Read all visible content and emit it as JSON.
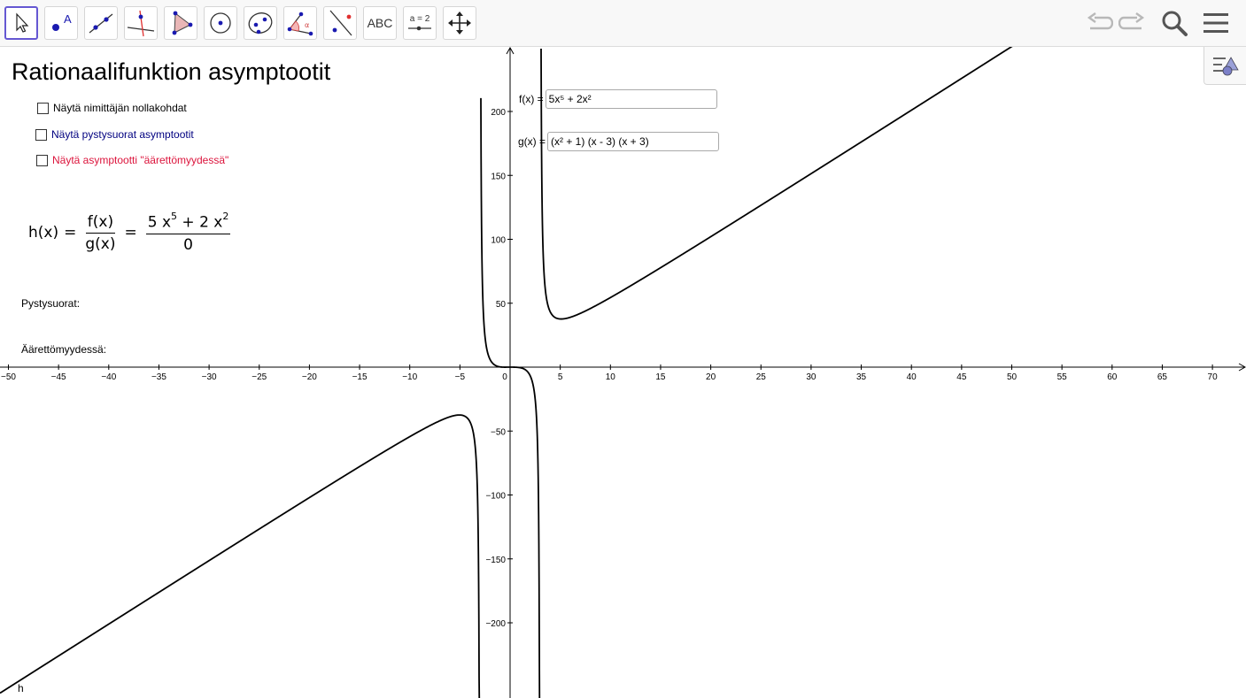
{
  "toolbar": {
    "tools": [
      {
        "name": "move-tool"
      },
      {
        "name": "point-tool",
        "label": "A"
      },
      {
        "name": "line-tool"
      },
      {
        "name": "perpendicular-line-tool"
      },
      {
        "name": "polygon-tool"
      },
      {
        "name": "circle-tool"
      },
      {
        "name": "ellipse-tool"
      },
      {
        "name": "angle-tool",
        "label": "α"
      },
      {
        "name": "reflect-tool"
      },
      {
        "name": "text-tool",
        "label": "ABC"
      },
      {
        "name": "slider-tool",
        "label": "a = 2"
      },
      {
        "name": "move-graphics-view-tool"
      }
    ],
    "accent_color": "#6557d2"
  },
  "title": "Rationaalifunktion asymptootit",
  "checkboxes": [
    {
      "label": "Näytä nimittäjän nollakohdat",
      "checked": false,
      "color": "#000000"
    },
    {
      "label": "Näytä pystysuorat asymptootit",
      "checked": false,
      "color": "#000080"
    },
    {
      "label": "Näytä asymptootti \"äärettömyydessä\"",
      "checked": false,
      "color": "#dc143c"
    }
  ],
  "formula": {
    "lhs": "h(x)",
    "num": "f(x)",
    "den": "g(x)",
    "num2_a": "5 x",
    "num2_exp_a": "5",
    "num2_b": " + 2 x",
    "num2_exp_b": "2",
    "den2": "0"
  },
  "labels": {
    "vertical": "Pystysuorat:",
    "infinity": "Äärettömyydessä:",
    "curve": "h"
  },
  "inputs": {
    "f_label": "f(x) =",
    "f_value": "5x⁵ + 2x²",
    "g_label": "g(x) =",
    "g_value": "(x² + 1) (x - 3) (x + 3)"
  },
  "axes": {
    "x_ticks": [
      -50,
      -45,
      -40,
      -35,
      -30,
      -25,
      -20,
      -15,
      -10,
      -5,
      0,
      5,
      10,
      15,
      20,
      25,
      30,
      35,
      40,
      45,
      50,
      55,
      60,
      65,
      70
    ],
    "y_ticks": [
      -200,
      -150,
      -100,
      -50,
      50,
      100,
      150,
      200
    ],
    "x_range": [
      -51,
      73
    ],
    "y_range": [
      -256,
      250
    ],
    "grid": false
  }
}
